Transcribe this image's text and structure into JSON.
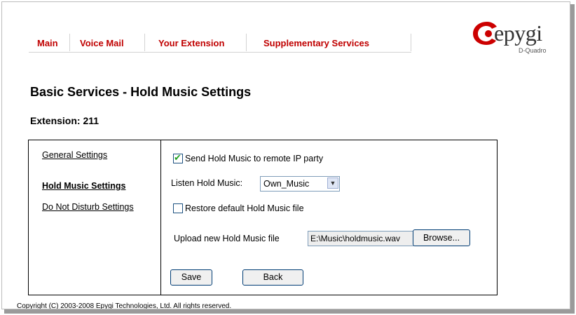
{
  "nav": {
    "main": "Main",
    "voice_mail": "Voice Mail",
    "your_extension": "Your Extension",
    "supplementary": "Supplementary Services"
  },
  "logo": {
    "text": "epygi",
    "sub": "D-Quadro"
  },
  "page_title": "Basic Services - Hold Music Settings",
  "extension_label": "Extension: 211",
  "sidebar": {
    "items": [
      {
        "label": "General Settings"
      },
      {
        "label": "Hold Music Settings"
      },
      {
        "label": "Do Not Disturb Settings"
      }
    ]
  },
  "form": {
    "send_hold_music": {
      "label": "Send Hold Music to remote IP party",
      "checked": true
    },
    "listen_label": "Listen Hold Music:",
    "listen_value": "Own_Music",
    "restore_default": {
      "label": "Restore default Hold Music file",
      "checked": false
    },
    "upload_label": "Upload new Hold Music file",
    "upload_value": "E:\\Music\\holdmusic.wav",
    "browse": "Browse...",
    "save": "Save",
    "back": "Back"
  },
  "footer": {
    "prefix": "Copyright (C) 2003-2008 ",
    "company": "Epygi Technologies, Ltd",
    "suffix": ". All rights reserved."
  },
  "colors": {
    "nav_link": "#c00000",
    "logo_red": "#cc0000",
    "check": "#21a121"
  }
}
